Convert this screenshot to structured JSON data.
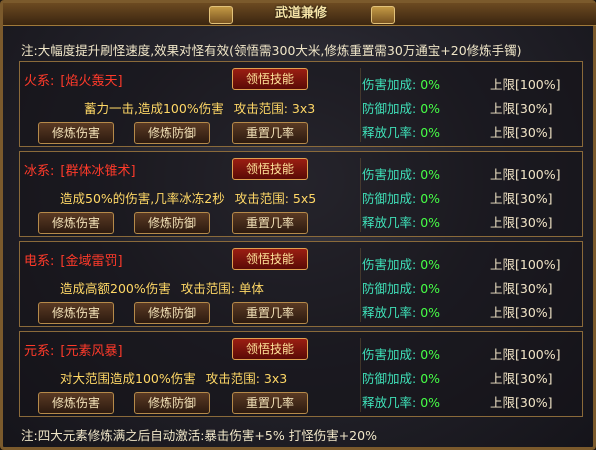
{
  "window": {
    "title": "武道兼修"
  },
  "notes": {
    "top": "注:大幅度提升刷怪速度,效果对怪有效(领悟需300大米,修炼重置需30万通宝+20修炼手镯)",
    "bottom": "注:四大元素修炼满之后自动激活:暴击伤害+5% 打怪伤害+20%"
  },
  "labels": {
    "learn": "领悟技能",
    "train_damage": "修炼伤害",
    "train_defense": "修炼防御",
    "reset_rate": "重置几率",
    "stat_damage": "伤害加成:",
    "stat_defense": "防御加成:",
    "stat_release": "释放几率:"
  },
  "elements": [
    {
      "element": "火系:",
      "skill": "[焰火轰天]",
      "effect": "蓄力一击,造成100%伤害",
      "range": "攻击范围: 3x3",
      "damage": "0%",
      "defense": "0%",
      "release": "0%",
      "damage_limit": "上限[100%]",
      "defense_limit": "上限[30%]",
      "release_limit": "上限[30%]"
    },
    {
      "element": "冰系:",
      "skill": "[群体冰锥术]",
      "effect": "造成50%的伤害,几率冰冻2秒",
      "range": "攻击范围: 5x5",
      "damage": "0%",
      "defense": "0%",
      "release": "0%",
      "damage_limit": "上限[100%]",
      "defense_limit": "上限[30%]",
      "release_limit": "上限[30%]"
    },
    {
      "element": "电系:",
      "skill": "[金域雷罚]",
      "effect": "造成高额200%伤害",
      "range": "攻击范围: 单体",
      "damage": "0%",
      "defense": "0%",
      "release": "0%",
      "damage_limit": "上限[100%]",
      "defense_limit": "上限[30%]",
      "release_limit": "上限[30%]"
    },
    {
      "element": "元系:",
      "skill": "[元素风暴]",
      "effect": "对大范围造成100%伤害",
      "range": "攻击范围: 3x3",
      "damage": "0%",
      "defense": "0%",
      "release": "0%",
      "damage_limit": "上限[100%]",
      "defense_limit": "上限[30%]",
      "release_limit": "上限[30%]"
    }
  ]
}
